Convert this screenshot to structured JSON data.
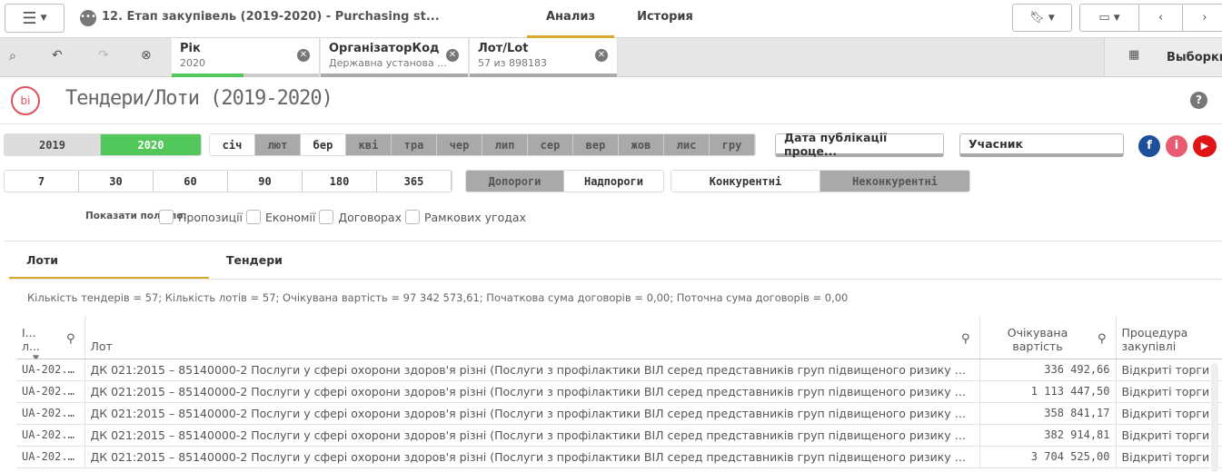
{
  "header": {
    "app_title": "12. Етап закупівель (2019-2020) - Purchasing st...",
    "tabs": [
      {
        "label": "Анализ",
        "active": true
      },
      {
        "label": "История",
        "active": false
      }
    ],
    "accent": "#d9a92b"
  },
  "selections": {
    "chips": [
      {
        "field": "Рік",
        "value": "2020",
        "fill": "#52c75a"
      },
      {
        "field": "ОрганізаторКод",
        "value": "Державна установа ..."
      },
      {
        "field": "Лот/Lot",
        "value": "57 из 898183"
      }
    ],
    "selections_label": "Выборки"
  },
  "sheet": {
    "title": "Тендери/Лоти (2019-2020)",
    "logo_text": "bi"
  },
  "filters": {
    "years": [
      {
        "label": "2019",
        "selected": false
      },
      {
        "label": "2020",
        "selected": true
      }
    ],
    "months": [
      {
        "label": "січ",
        "state": "white"
      },
      {
        "label": "лют",
        "state": "gray"
      },
      {
        "label": "бер",
        "state": "white"
      },
      {
        "label": "кві",
        "state": "gray"
      },
      {
        "label": "тра",
        "state": "gray"
      },
      {
        "label": "чер",
        "state": "gray"
      },
      {
        "label": "лип",
        "state": "gray"
      },
      {
        "label": "сер",
        "state": "gray"
      },
      {
        "label": "вер",
        "state": "gray"
      },
      {
        "label": "жов",
        "state": "gray"
      },
      {
        "label": "лис",
        "state": "gray"
      },
      {
        "label": "гру",
        "state": "gray"
      }
    ],
    "days": [
      "7",
      "30",
      "60",
      "90",
      "180",
      "365"
    ],
    "threshold": [
      {
        "label": "Допороги",
        "state": "gray"
      },
      {
        "label": "Надпороги",
        "state": "white"
      }
    ],
    "competition": [
      {
        "label": "Конкурентні",
        "state": "white"
      },
      {
        "label": "Неконкурентні",
        "state": "gray"
      }
    ],
    "date_filter": "Дата публікації проце...",
    "participant_filter": "Учасник",
    "show_fields_label": "Показати поля по:",
    "show_fields": [
      "Пропозиції",
      "Економії",
      "Договорах",
      "Рамкових угодах"
    ]
  },
  "content_tabs": [
    {
      "label": "Лоти",
      "active": true
    },
    {
      "label": "Тендери",
      "active": false
    }
  ],
  "summary": "Кількість тендерів = 57; Кількість лотів = 57; Очікувана вартість = 97 342 573,61; Початкова сума договорів = 0,00; Поточна сума договорів = 0,00",
  "table": {
    "columns": [
      {
        "line1": "І...",
        "line2": "л..."
      },
      {
        "line1": "",
        "line2": "Лот"
      },
      {
        "line1": "Очікувана",
        "line2": "вартість"
      },
      {
        "line1": "Процедура",
        "line2": "закупівлі"
      }
    ],
    "rows": [
      [
        "UA-202...",
        "ДК 021:2015 – 85140000-2 Послуги у сфері охорони здоров'я різні (Послуги з профілактики ВІЛ серед представників груп підвищеного ризику щ...",
        "336 492,66",
        "Відкриті торги і"
      ],
      [
        "UA-202...",
        "ДК 021:2015 – 85140000-2 Послуги у сфері охорони здоров'я різні (Послуги з профілактики ВІЛ серед представників груп підвищеного ризику щ...",
        "1 113 447,50",
        "Відкриті торги і"
      ],
      [
        "UA-202...",
        "ДК 021:2015 – 85140000-2 Послуги у сфері охорони здоров'я різні (Послуги з профілактики ВІЛ серед представників груп підвищеного ризику щ...",
        "358 841,17",
        "Відкриті торги і"
      ],
      [
        "UA-202...",
        "ДК 021:2015 – 85140000-2 Послуги у сфері охорони здоров'я різні (Послуги з профілактики ВІЛ серед представників груп підвищеного ризику щ...",
        "382 914,81",
        "Відкриті торги і"
      ],
      [
        "UA-202...",
        "ДК 021:2015 – 85140000-2 Послуги у сфері охорони здоров'я різні (Послуги з профілактики ВІЛ серед представників груп підвищеного ризику щ...",
        "3 704 525,00",
        "Відкриті торги і"
      ]
    ]
  }
}
